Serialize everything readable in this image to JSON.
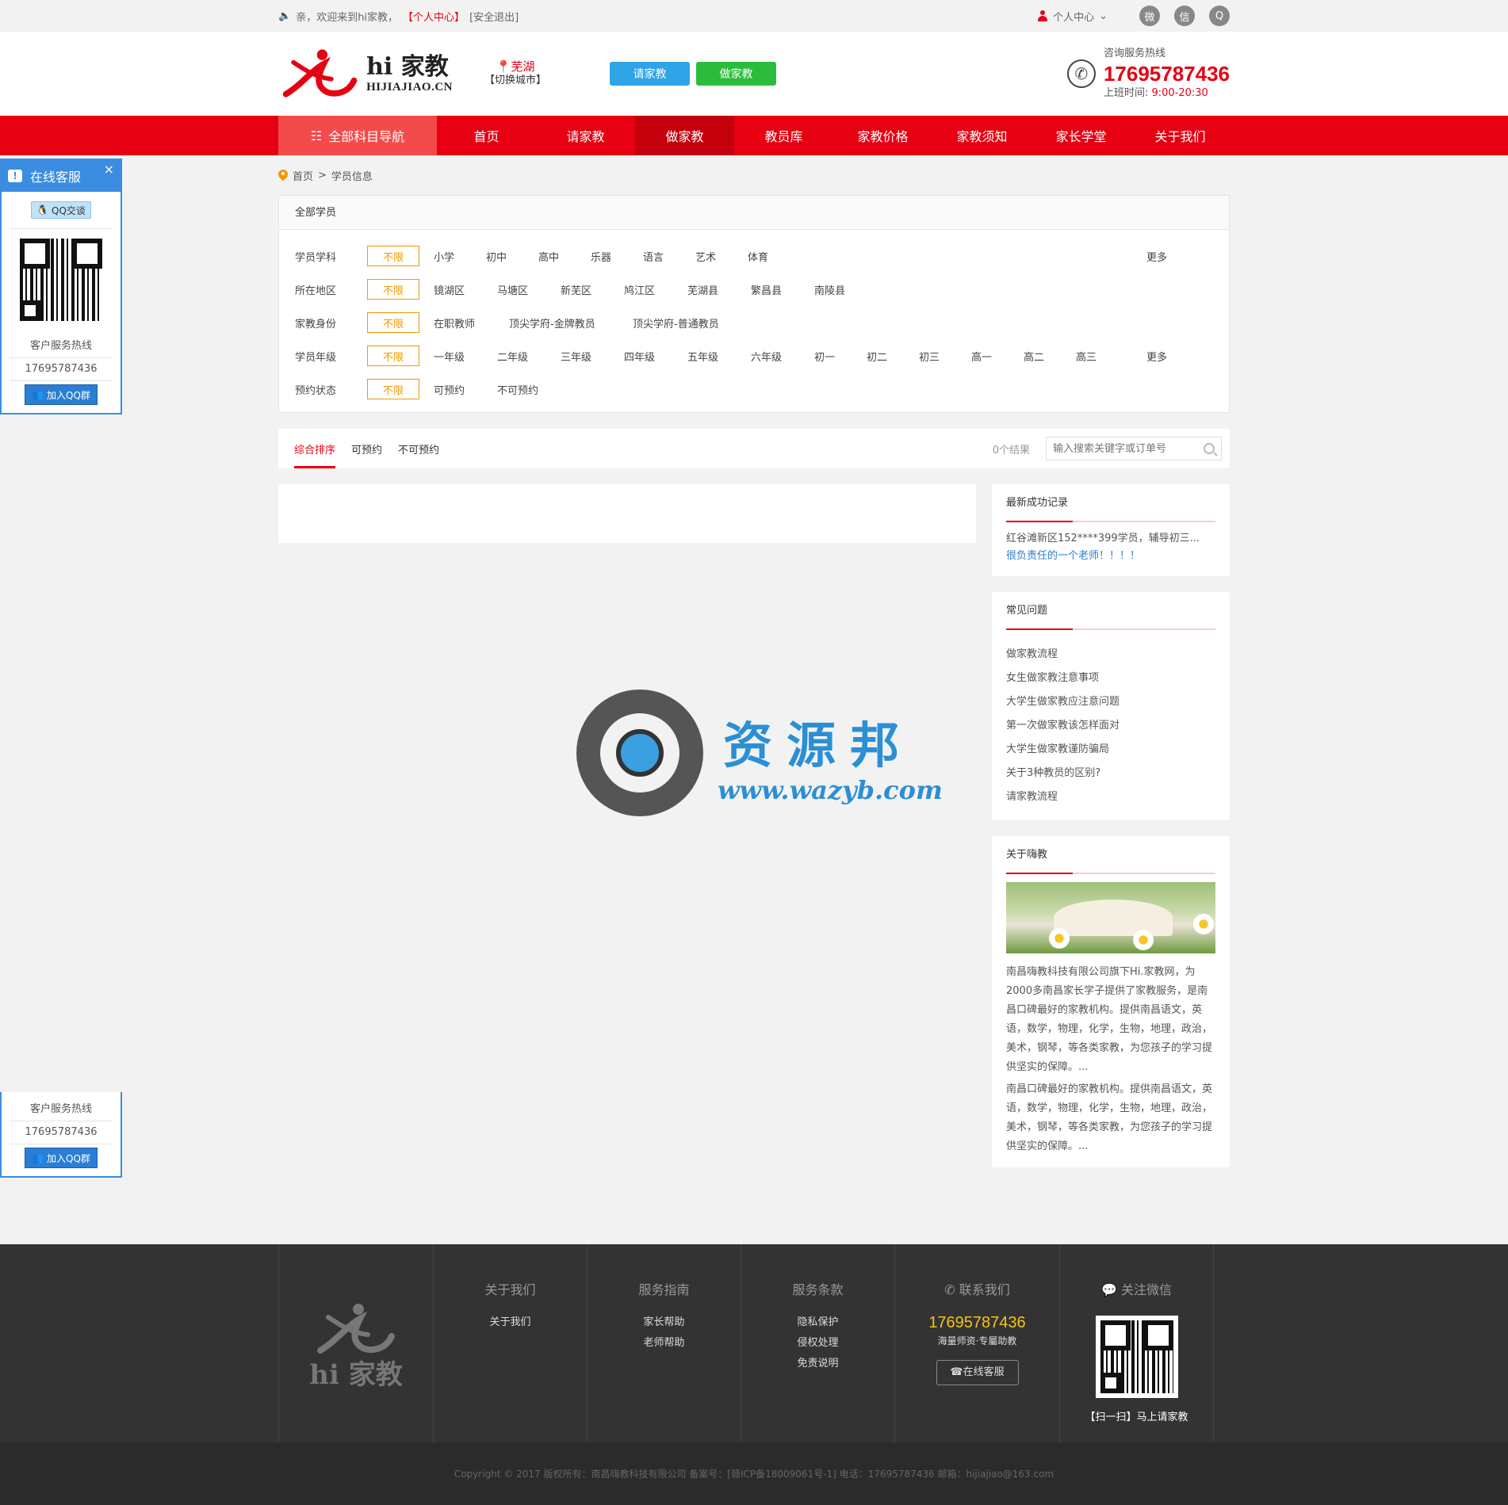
{
  "topbar": {
    "welcome": "亲，欢迎来到hi家教，",
    "user_center_link": "【个人中心】",
    "logout_link": "[安全退出]",
    "user_menu": "个人中心",
    "social": [
      "weibo-icon",
      "wechat-icon",
      "qq-icon"
    ]
  },
  "header": {
    "logo_cn": "hi 家教",
    "logo_en": "HIJIAJIAO.CN",
    "city": "芜湖",
    "switch_city": "【切换城市】",
    "btn_request": "请家教",
    "btn_teach": "做家教",
    "hotline_label": "咨询服务热线",
    "hotline_number": "17695787436",
    "hours_label": "上班时间:",
    "hours_value": "9:00-20:30"
  },
  "nav": {
    "all_subjects": "全部科目导航",
    "items": [
      "首页",
      "请家教",
      "做家教",
      "教员库",
      "家教价格",
      "家教须知",
      "家长学堂",
      "关于我们"
    ],
    "active_index": 2
  },
  "breadcrumb": {
    "home": "首页",
    "sep": ">",
    "current": "学员信息"
  },
  "filter": {
    "title": "全部学员",
    "unlimited": "不限",
    "more": "更多",
    "rows": [
      {
        "label": "学员学科",
        "options": [
          "小学",
          "初中",
          "高中",
          "乐器",
          "语言",
          "艺术",
          "体育"
        ],
        "has_more": true
      },
      {
        "label": "所在地区",
        "options": [
          "镜湖区",
          "马塘区",
          "新芜区",
          "鸠江区",
          "芜湖县",
          "繁昌县",
          "南陵县"
        ],
        "has_more": false
      },
      {
        "label": "家教身份",
        "options": [
          "在职教师",
          "顶尖学府-金牌教员",
          "顶尖学府-普通教员"
        ],
        "has_more": false
      },
      {
        "label": "学员年级",
        "options": [
          "一年级",
          "二年级",
          "三年级",
          "四年级",
          "五年级",
          "六年级",
          "初一",
          "初二",
          "初三",
          "高一",
          "高二",
          "高三"
        ],
        "has_more": true
      },
      {
        "label": "预约状态",
        "options": [
          "可预约",
          "不可预约"
        ],
        "has_more": false
      }
    ]
  },
  "sortbar": {
    "tabs": [
      "综合排序",
      "可预约",
      "不可预约"
    ],
    "result_count": "0个结果",
    "search_placeholder": "输入搜索关键字或订单号"
  },
  "sidebar": {
    "recent_title": "最新成功记录",
    "recent_text": "红谷滩新区152****399学员，辅导初三...",
    "recent_comment": "很负责任的一个老师！！！！",
    "faq_title": "常见问题",
    "faq_items": [
      "做家教流程",
      "女生做家教注意事项",
      "大学生做家教应注意问题",
      "第一次做家教该怎样面对",
      "大学生做家教谨防骗局",
      "关于3种教员的区别?",
      "请家教流程"
    ],
    "about_title": "关于嗨教",
    "about_p1": "南昌嗨教科技有限公司旗下Hi.家教网，为2000多南昌家长学子提供了家教服务，是南昌口碑最好的家教机构。提供南昌语文，英语，数学，物理，化学，生物，地理，政治，美术，钢琴，等各类家教，为您孩子的学习提供坚实的保障。...",
    "about_p2": "南昌口碑最好的家教机构。提供南昌语文，英语，数学，物理，化学，生物，地理，政治，美术，钢琴，等各类家教，为您孩子的学习提供坚实的保障。..."
  },
  "watermark": {
    "title": "资源邦",
    "url": "www.wazyb.com"
  },
  "float_service": {
    "title": "在线客服",
    "close": "×",
    "qq_chat": "QQ交谈",
    "hotline_label": "客户服务热线",
    "hotline_number": "17695787436",
    "join_qq": "加入QQ群"
  },
  "footer": {
    "logo_cn": "hi 家教",
    "col_about_title": "关于我们",
    "col_about_items": [
      "关于我们"
    ],
    "col_guide_title": "服务指南",
    "col_guide_items": [
      "家长帮助",
      "老师帮助"
    ],
    "col_terms_title": "服务条款",
    "col_terms_items": [
      "隐私保护",
      "侵权处理",
      "免责说明"
    ],
    "contact_title": "联系我们",
    "contact_number": "17695787436",
    "contact_slogan": "海量师资·专屬助教",
    "online_service": "在线客服",
    "wechat_title": "关注微信",
    "wechat_caption": "【扫一扫】马上请家教"
  },
  "copyright": "Copyright © 2017 版权所有：南昌嗨教科技有限公司    备案号：[赣ICP备18009061号-1]    电话：17695787436    邮箱：hijiajiao@163.com"
}
